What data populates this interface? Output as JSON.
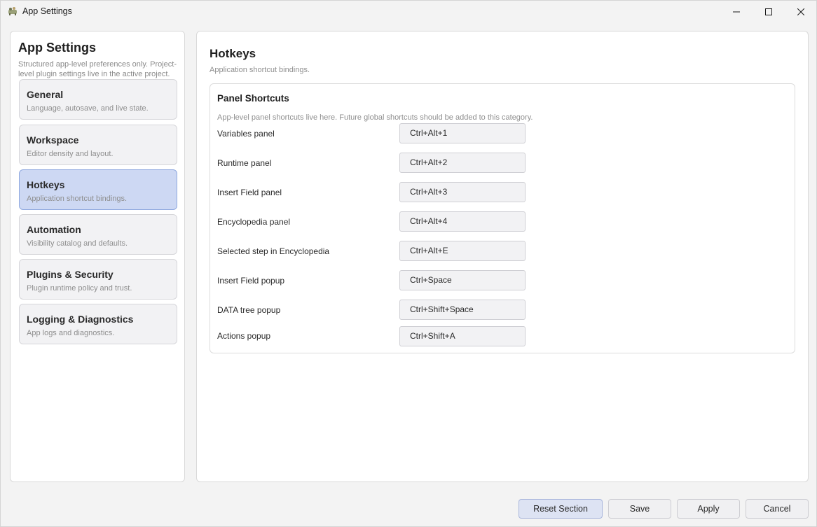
{
  "window": {
    "title": "App Settings"
  },
  "sidebar": {
    "title": "App Settings",
    "description": "Structured app-level preferences only. Project-level plugin settings live in the active project.",
    "items": [
      {
        "label": "General",
        "subtitle": "Language, autosave, and live state."
      },
      {
        "label": "Workspace",
        "subtitle": "Editor density and layout."
      },
      {
        "label": "Hotkeys",
        "subtitle": "Application shortcut bindings."
      },
      {
        "label": "Automation",
        "subtitle": "Visibility catalog and defaults."
      },
      {
        "label": "Plugins & Security",
        "subtitle": "Plugin runtime policy and trust."
      },
      {
        "label": "Logging & Diagnostics",
        "subtitle": "App logs and diagnostics."
      }
    ],
    "active_index": 2
  },
  "main": {
    "title": "Hotkeys",
    "subtitle": "Application shortcut bindings.",
    "group": {
      "title": "Panel Shortcuts",
      "description": "App-level panel shortcuts live here. Future global shortcuts should be added to this category.",
      "rows": [
        {
          "label": "Variables panel",
          "value": "Ctrl+Alt+1"
        },
        {
          "label": "Runtime panel",
          "value": "Ctrl+Alt+2"
        },
        {
          "label": "Insert Field panel",
          "value": "Ctrl+Alt+3"
        },
        {
          "label": "Encyclopedia panel",
          "value": "Ctrl+Alt+4"
        },
        {
          "label": "Selected step in Encyclopedia",
          "value": "Ctrl+Alt+E"
        },
        {
          "label": "Insert Field popup",
          "value": "Ctrl+Space"
        },
        {
          "label": "DATA tree popup",
          "value": "Ctrl+Shift+Space"
        },
        {
          "label": "Actions popup",
          "value": "Ctrl+Shift+A"
        }
      ]
    }
  },
  "footer": {
    "reset_label": "Reset Section",
    "save_label": "Save",
    "apply_label": "Apply",
    "cancel_label": "Cancel"
  },
  "icons": {
    "app": "app-icon",
    "minimize": "minimize-icon",
    "maximize": "maximize-icon",
    "close": "close-icon"
  },
  "colors": {
    "accent_active_bg": "#cdd8f3",
    "accent_active_border": "#8fa8df"
  }
}
